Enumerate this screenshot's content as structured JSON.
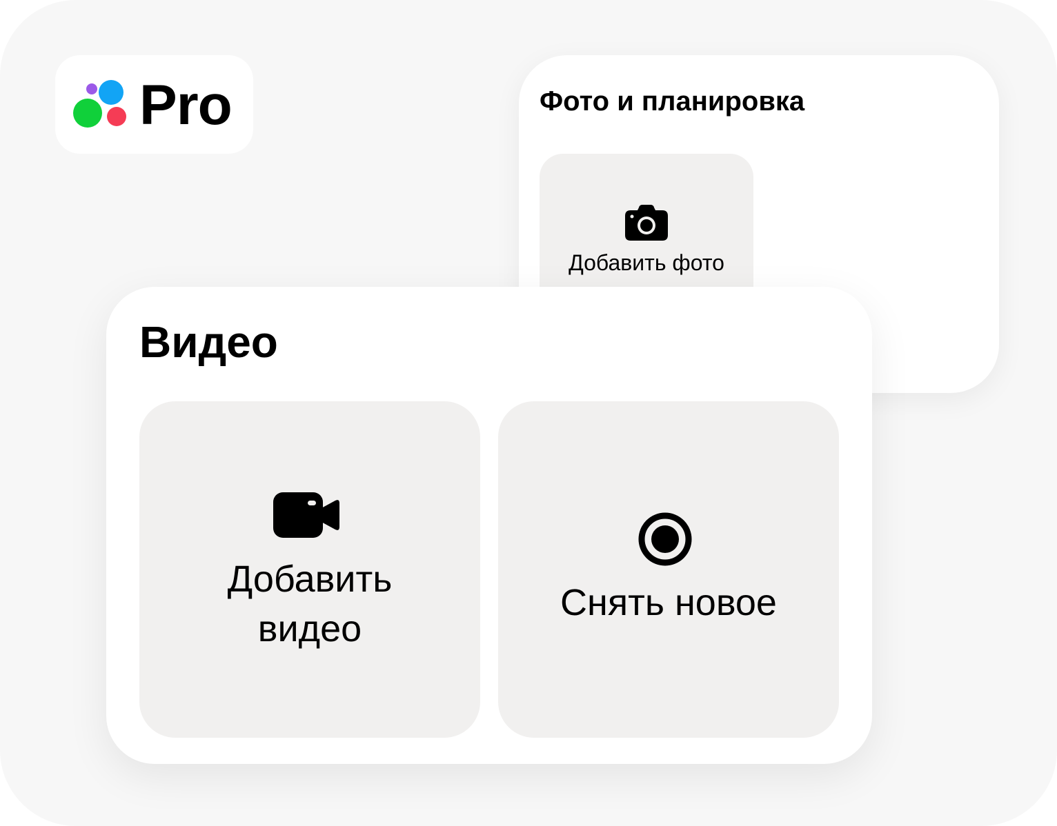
{
  "logo": {
    "text": "Pro",
    "dot_colors": {
      "purple": "#9b59e8",
      "blue": "#12a4f5",
      "green": "#10d03a",
      "red": "#f53c55"
    }
  },
  "photo_section": {
    "title": "Фото и планировка",
    "add_photo": {
      "icon": "camera-icon",
      "label": "Добавить фото"
    }
  },
  "video_section": {
    "title": "Видео",
    "add_video": {
      "icon": "video-camera-icon",
      "label_line1": "Добавить",
      "label_line2": "видео"
    },
    "record_new": {
      "icon": "record-icon",
      "label": "Снять новое"
    }
  },
  "colors": {
    "background": "#f7f7f7",
    "card": "#ffffff",
    "tile": "#f1f0ef",
    "text": "#000000"
  }
}
